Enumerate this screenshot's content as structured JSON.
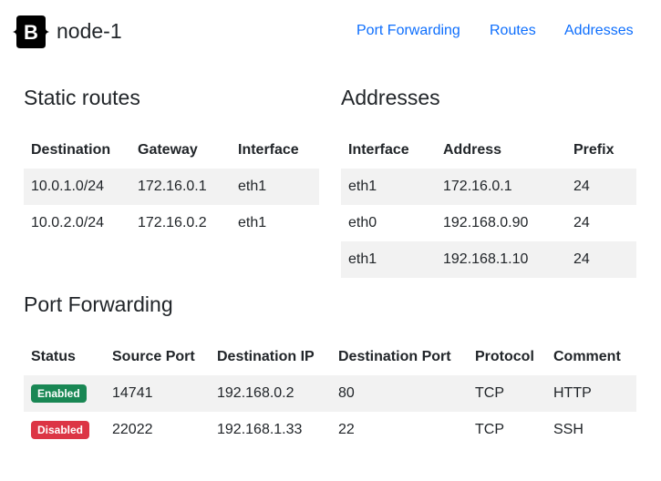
{
  "brand": {
    "logo_letter": "B",
    "name": "node-1"
  },
  "nav": [
    {
      "label": "Port Forwarding"
    },
    {
      "label": "Routes"
    },
    {
      "label": "Addresses"
    }
  ],
  "static_routes": {
    "title": "Static routes",
    "headers": [
      "Destination",
      "Gateway",
      "Interface"
    ],
    "rows": [
      [
        "10.0.1.0/24",
        "172.16.0.1",
        "eth1"
      ],
      [
        "10.0.2.0/24",
        "172.16.0.2",
        "eth1"
      ]
    ]
  },
  "addresses": {
    "title": "Addresses",
    "headers": [
      "Interface",
      "Address",
      "Prefix"
    ],
    "rows": [
      [
        "eth1",
        "172.16.0.1",
        "24"
      ],
      [
        "eth0",
        "192.168.0.90",
        "24"
      ],
      [
        "eth1",
        "192.168.1.10",
        "24"
      ]
    ]
  },
  "port_forwarding": {
    "title": "Port Forwarding",
    "headers": [
      "Status",
      "Source Port",
      "Destination IP",
      "Destination Port",
      "Protocol",
      "Comment"
    ],
    "rows": [
      {
        "status": "Enabled",
        "source_port": "14741",
        "destination_ip": "192.168.0.2",
        "destination_port": "80",
        "protocol": "TCP",
        "comment": "HTTP"
      },
      {
        "status": "Disabled",
        "source_port": "22022",
        "destination_ip": "192.168.1.33",
        "destination_port": "22",
        "protocol": "TCP",
        "comment": "SSH"
      }
    ]
  },
  "colors": {
    "link": "#0d6efd",
    "enabled_badge": "#198754",
    "disabled_badge": "#dc3545",
    "stripe": "#f2f2f2"
  }
}
